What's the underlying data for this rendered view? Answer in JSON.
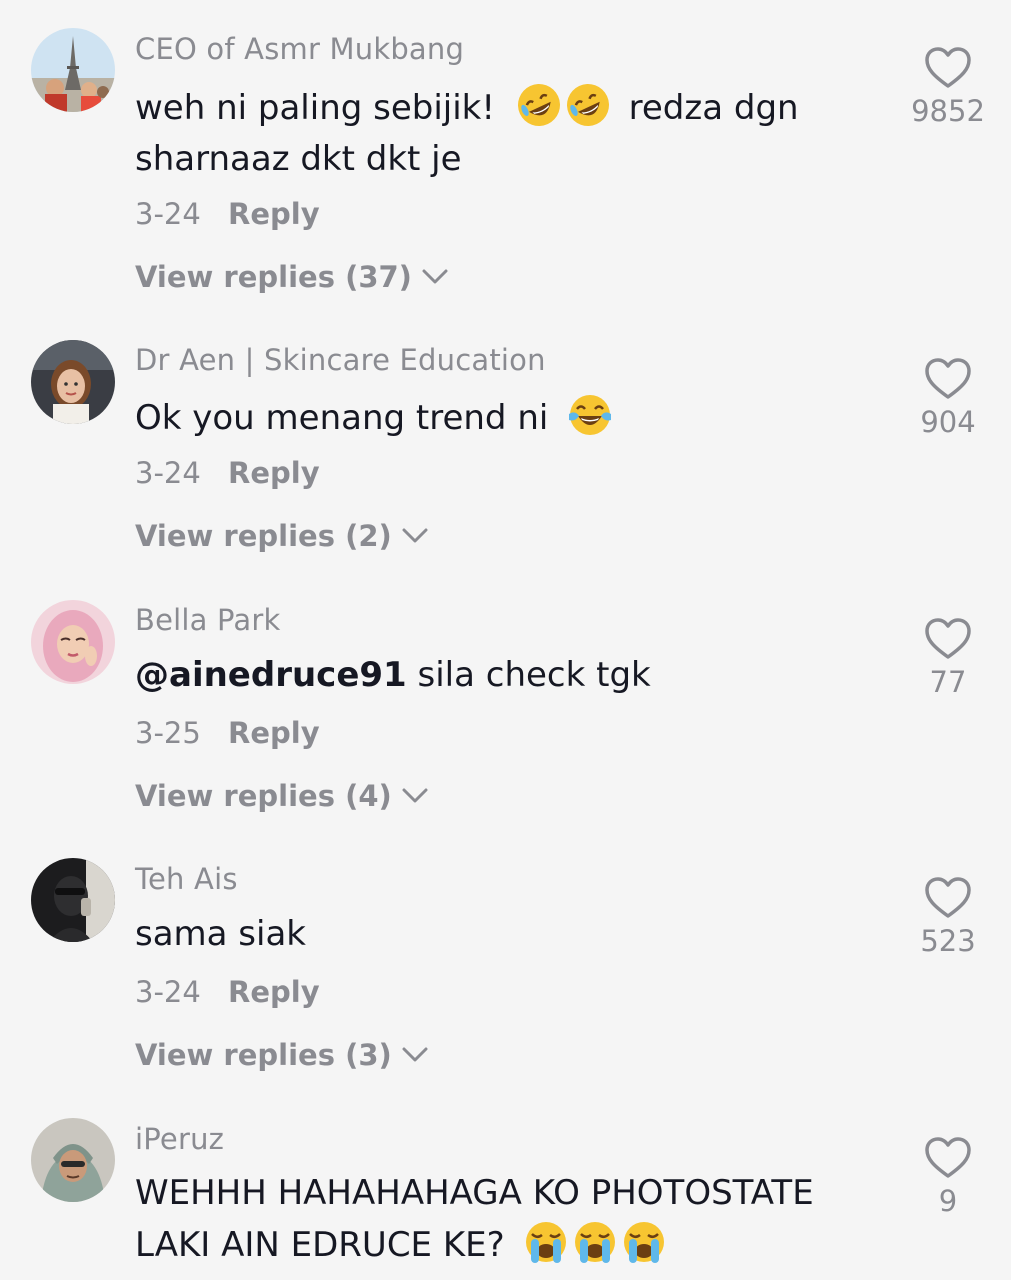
{
  "reply_label": "Reply",
  "comments": [
    {
      "username": "CEO of Asmr Mukbang",
      "text_lines": [
        "weh ni paling sebijik!",
        "redza dgn",
        "sharnaaz dkt dkt je"
      ],
      "date": "3-24",
      "likes": "9852",
      "view_replies": "View replies (37)",
      "emoji": "rolling-on-floor-laughing"
    },
    {
      "username": "Dr Aen | Skincare Education",
      "text": "Ok you menang trend ni",
      "date": "3-24",
      "likes": "904",
      "view_replies": "View replies (2)",
      "emoji": "tears-of-joy"
    },
    {
      "username": "Bella Park",
      "mention": "@ainedruce91",
      "text": "sila check tgk",
      "date": "3-25",
      "likes": "77",
      "view_replies": "View replies (4)"
    },
    {
      "username": "Teh Ais",
      "text": "sama siak",
      "date": "3-24",
      "likes": "523",
      "view_replies": "View replies (3)"
    },
    {
      "username": "iPeruz",
      "text_lines": [
        "WEHHH HAHAHAHAGA KO PHOTOSTATE",
        "LAKI AIN EDRUCE KE?"
      ],
      "likes": "9",
      "emoji": "loudly-crying"
    }
  ],
  "colors": {
    "background": "#f5f5f5",
    "text": "#161823",
    "secondary": "#8a8b91"
  }
}
